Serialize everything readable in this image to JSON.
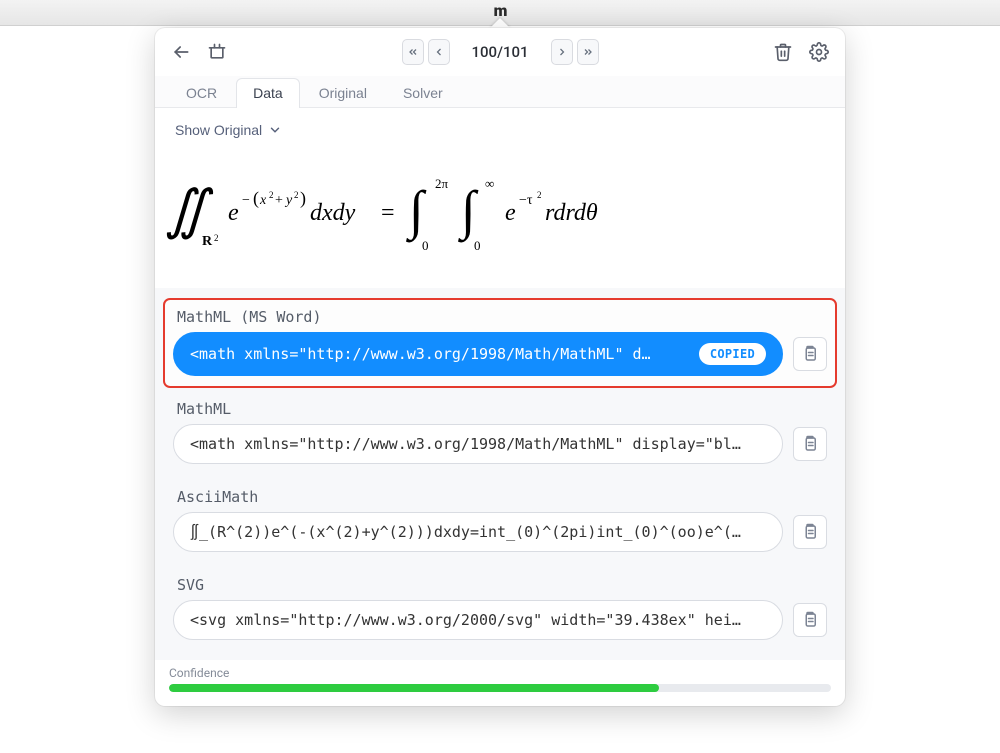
{
  "app_logo_glyph": "m",
  "toolbar": {
    "page_current": 100,
    "page_total": 101
  },
  "tabs": [
    {
      "id": "ocr",
      "label": "OCR",
      "active": false
    },
    {
      "id": "data",
      "label": "Data",
      "active": true
    },
    {
      "id": "original",
      "label": "Original",
      "active": false
    },
    {
      "id": "solver",
      "label": "Solver",
      "active": false
    }
  ],
  "show_original_label": "Show Original",
  "formula_latex": "\\iint_{\\mathbf{R}^2} e^{-(x^2+y^2)} dx\\,dy = \\int_0^{2\\pi}\\int_0^{\\infty} e^{-\\tau^2} r\\,dr\\,d\\theta",
  "results": [
    {
      "id": "mathml-word",
      "label": "MathML (MS Word)",
      "snippet": "<math xmlns=\"http://www.w3.org/1998/Math/MathML\" d…",
      "active": true,
      "copied_label": "COPIED"
    },
    {
      "id": "mathml",
      "label": "MathML",
      "snippet": "<math xmlns=\"http://www.w3.org/1998/Math/MathML\" display=\"bl…",
      "active": false
    },
    {
      "id": "asciimath",
      "label": "AsciiMath",
      "snippet": "∬_(R^(2))e^(-(x^(2)+y^(2)))dxdy=int_(0)^(2pi)int_(0)^(oo)e^(…",
      "active": false
    },
    {
      "id": "svg",
      "label": "SVG",
      "snippet": "<svg xmlns=\"http://www.w3.org/2000/svg\" width=\"39.438ex\" hei…",
      "active": false
    }
  ],
  "confidence": {
    "label": "Confidence",
    "percent": 74
  }
}
